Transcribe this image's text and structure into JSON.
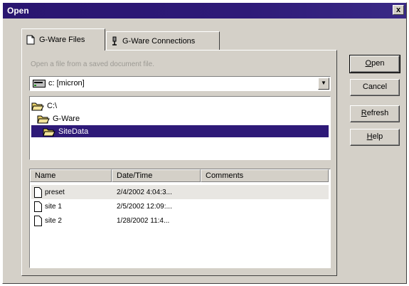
{
  "window": {
    "title": "Open",
    "close_glyph": "x"
  },
  "tabs": [
    {
      "label": "G-Ware Files",
      "icon": "document-icon",
      "active": true
    },
    {
      "label": "G-Ware Connections",
      "icon": "connection-icon",
      "active": false
    }
  ],
  "panel": {
    "hint": "Open a file from a saved document file.",
    "location": {
      "value": "c: [micron]",
      "icon": "drive-icon",
      "arrow": "▼"
    },
    "folders": [
      {
        "label": "C:\\",
        "icon": "open-folder-icon",
        "selected": false
      },
      {
        "label": "G-Ware",
        "icon": "open-folder-icon",
        "selected": false
      },
      {
        "label": "SiteData",
        "icon": "open-folder-icon",
        "selected": true
      }
    ],
    "file_list": {
      "columns": [
        "Name",
        "Date/Time",
        "Comments"
      ],
      "rows": [
        {
          "name": "preset",
          "datetime": "2/4/2002 4:04:3...",
          "comments": ""
        },
        {
          "name": "site 1",
          "datetime": "2/5/2002 12:09:...",
          "comments": ""
        },
        {
          "name": "site 2",
          "datetime": "1/28/2002 11:4...",
          "comments": ""
        }
      ]
    }
  },
  "buttons": {
    "open": {
      "pre": "",
      "key": "O",
      "post": "pen"
    },
    "cancel": {
      "label": "Cancel"
    },
    "refresh": {
      "pre": "",
      "key": "R",
      "post": "efresh"
    },
    "help": {
      "pre": "",
      "key": "H",
      "post": "elp"
    }
  },
  "colors": {
    "title_bar": "#2e1a78",
    "selection": "#2e1a78",
    "face": "#d4d0c8"
  }
}
